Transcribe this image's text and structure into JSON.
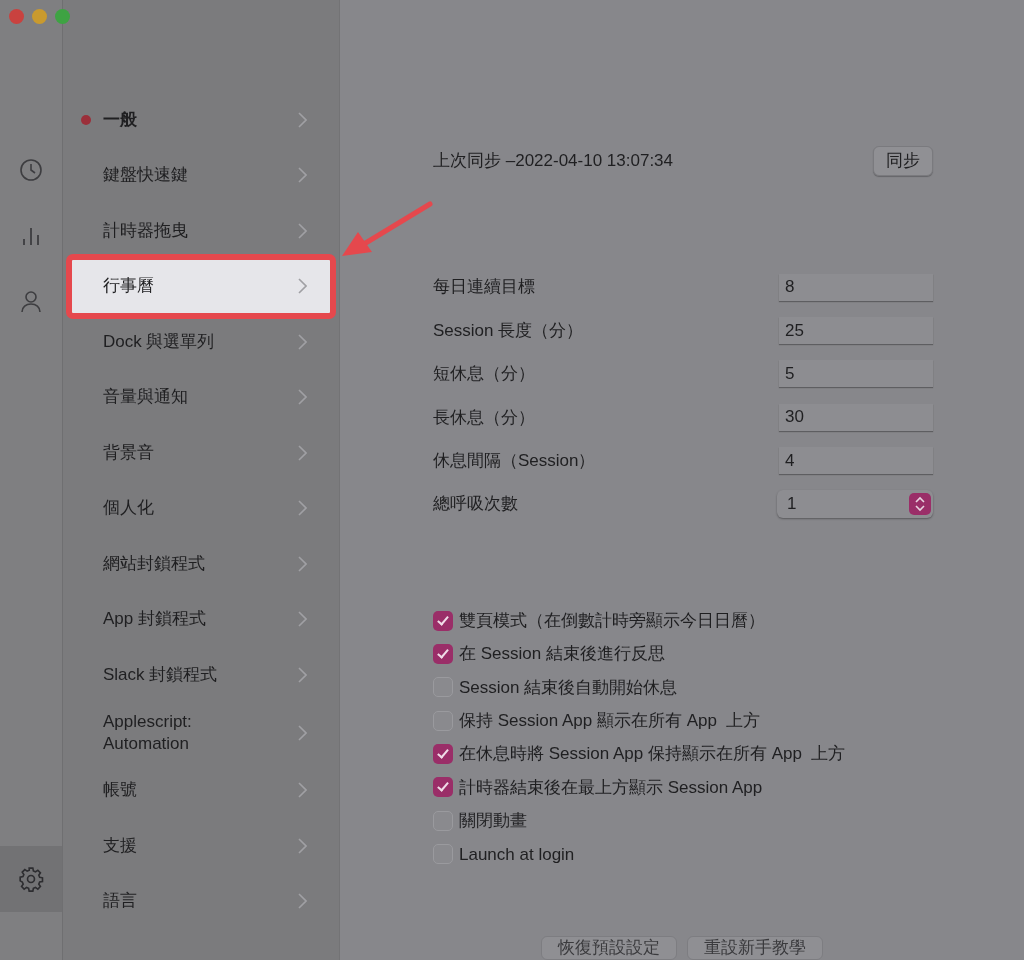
{
  "rail": [
    {
      "kind": "clock",
      "selected": false
    },
    {
      "kind": "chart",
      "selected": false
    },
    {
      "kind": "person",
      "selected": false
    },
    {
      "kind": "gear",
      "selected": true
    }
  ],
  "sidebar": {
    "items": [
      {
        "label": "一般",
        "selected": true,
        "highlighted": false,
        "unread_dot": true,
        "annotated": false
      },
      {
        "label": "鍵盤快速鍵",
        "selected": false,
        "highlighted": false,
        "unread_dot": false,
        "annotated": false
      },
      {
        "label": "計時器拖曳",
        "selected": false,
        "highlighted": false,
        "unread_dot": false,
        "annotated": false
      },
      {
        "label": "行事曆",
        "selected": false,
        "highlighted": true,
        "unread_dot": false,
        "annotated": true
      },
      {
        "label": "Dock 與選單列",
        "selected": false,
        "highlighted": false,
        "unread_dot": false,
        "annotated": false
      },
      {
        "label": "音量與通知",
        "selected": false,
        "highlighted": false,
        "unread_dot": false,
        "annotated": false
      },
      {
        "label": "背景音",
        "selected": false,
        "highlighted": false,
        "unread_dot": false,
        "annotated": false
      },
      {
        "label": "個人化",
        "selected": false,
        "highlighted": false,
        "unread_dot": false,
        "annotated": false
      },
      {
        "label": "網站封鎖程式",
        "selected": false,
        "highlighted": false,
        "unread_dot": false,
        "annotated": false
      },
      {
        "label": "App 封鎖程式",
        "selected": false,
        "highlighted": false,
        "unread_dot": false,
        "annotated": false
      },
      {
        "label": "Slack 封鎖程式",
        "selected": false,
        "highlighted": false,
        "unread_dot": false,
        "annotated": false
      },
      {
        "label": "Applescript:\nAutomation",
        "selected": false,
        "highlighted": false,
        "unread_dot": false,
        "annotated": false
      },
      {
        "label": "帳號",
        "selected": false,
        "highlighted": false,
        "unread_dot": false,
        "annotated": false
      },
      {
        "label": "支援",
        "selected": false,
        "highlighted": false,
        "unread_dot": false,
        "annotated": false
      },
      {
        "label": "語言",
        "selected": false,
        "highlighted": false,
        "unread_dot": false,
        "annotated": false
      }
    ]
  },
  "sync": {
    "text": "上次同步 –2022-04-10 13:07:34",
    "button": "同步"
  },
  "fields": [
    {
      "label": "每日連續目標",
      "value": "8",
      "kind": "text"
    },
    {
      "label": "Session 長度（分）",
      "value": "25",
      "kind": "text"
    },
    {
      "label": "短休息（分）",
      "value": "5",
      "kind": "text"
    },
    {
      "label": "長休息（分）",
      "value": "30",
      "kind": "text"
    },
    {
      "label": "休息間隔（Session）",
      "value": "4",
      "kind": "text"
    },
    {
      "label": "總呼吸次數",
      "value": "1",
      "kind": "stepper"
    }
  ],
  "checkboxes": [
    {
      "label": "雙頁模式（在倒數計時旁顯示今日日曆）",
      "checked": true
    },
    {
      "label": "在 Session 結束後進行反思",
      "checked": true
    },
    {
      "label": "Session 結束後自動開始休息",
      "checked": false
    },
    {
      "label": "保持 Session App 顯示在所有 App  上方",
      "checked": false
    },
    {
      "label": "在休息時將 Session App 保持顯示在所有 App  上方",
      "checked": true
    },
    {
      "label": "計時器結束後在最上方顯示 Session App",
      "checked": true
    },
    {
      "label": "關閉動畫",
      "checked": false
    },
    {
      "label": "Launch at login",
      "checked": false
    }
  ],
  "footer_buttons": [
    {
      "label": "恢復預設設定"
    },
    {
      "label": "重設新手教學"
    }
  ]
}
